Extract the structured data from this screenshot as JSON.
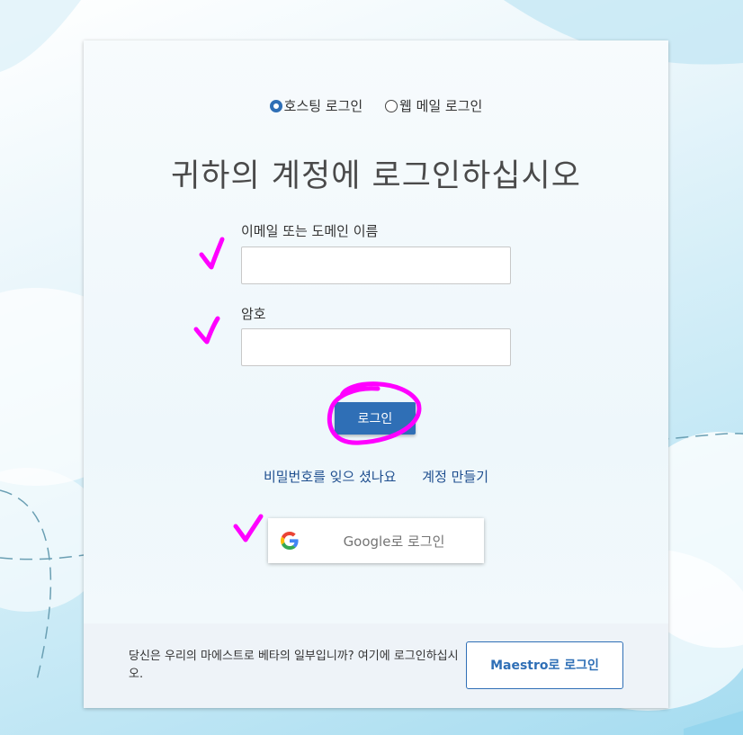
{
  "login_type": {
    "options": [
      {
        "label": "호스팅 로그인",
        "selected": true
      },
      {
        "label": "웹 메일 로그인",
        "selected": false
      }
    ]
  },
  "heading": "귀하의 계정에 로그인하십시오",
  "form": {
    "email_label": "이메일 또는 도메인 이름",
    "email_value": "",
    "password_label": "암호",
    "password_value": "",
    "login_button": "로그인"
  },
  "links": {
    "forgot_password": "비밀번호를 잊으 셨나요",
    "create_account": "계정 만들기"
  },
  "google": {
    "label": "Google로 로그인",
    "icon": "google-g-icon"
  },
  "footer": {
    "text": "당신은 우리의 마에스트로 베타의 일부입니까? 여기에 로그인하십시오.",
    "maestro_button": "Maestro로 로그인"
  },
  "colors": {
    "accent": "#2f6fb6",
    "link": "#1f4f8f",
    "annotation": "#ff00ff"
  }
}
